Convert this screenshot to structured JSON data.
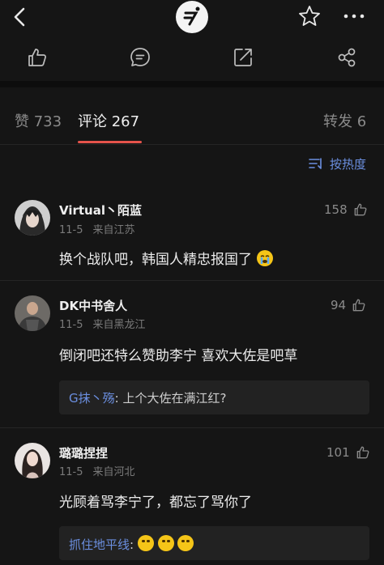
{
  "tabs": [
    {
      "label": "赞 733"
    },
    {
      "label": "评论 267"
    },
    {
      "label": "转发 6"
    }
  ],
  "sort": {
    "label": "按热度"
  },
  "comments": [
    {
      "user": "Virtual丶陌蓝",
      "date": "11-5",
      "location": "来自江苏",
      "text": "换个战队吧，韩国人精忠报国了",
      "likes": "158"
    },
    {
      "user": "DK中书舍人",
      "date": "11-5",
      "location": "来自黑龙江",
      "text": "倒闭吧还特么赞助李宁 喜欢大佐是吧草",
      "likes": "94",
      "reply": {
        "name": "G抹丶殇",
        "text": "上个大佐在满江红?"
      }
    },
    {
      "user": "璐璐捏捏",
      "date": "11-5",
      "location": "来自河北",
      "text": "光顾着骂李宁了，都忘了骂你了",
      "likes": "101",
      "reply": {
        "name": "抓住地平线",
        "text": ""
      }
    }
  ],
  "colors": {
    "accent_red": "#e5534b",
    "link_blue": "#6b8fe0",
    "background": "#151515"
  }
}
